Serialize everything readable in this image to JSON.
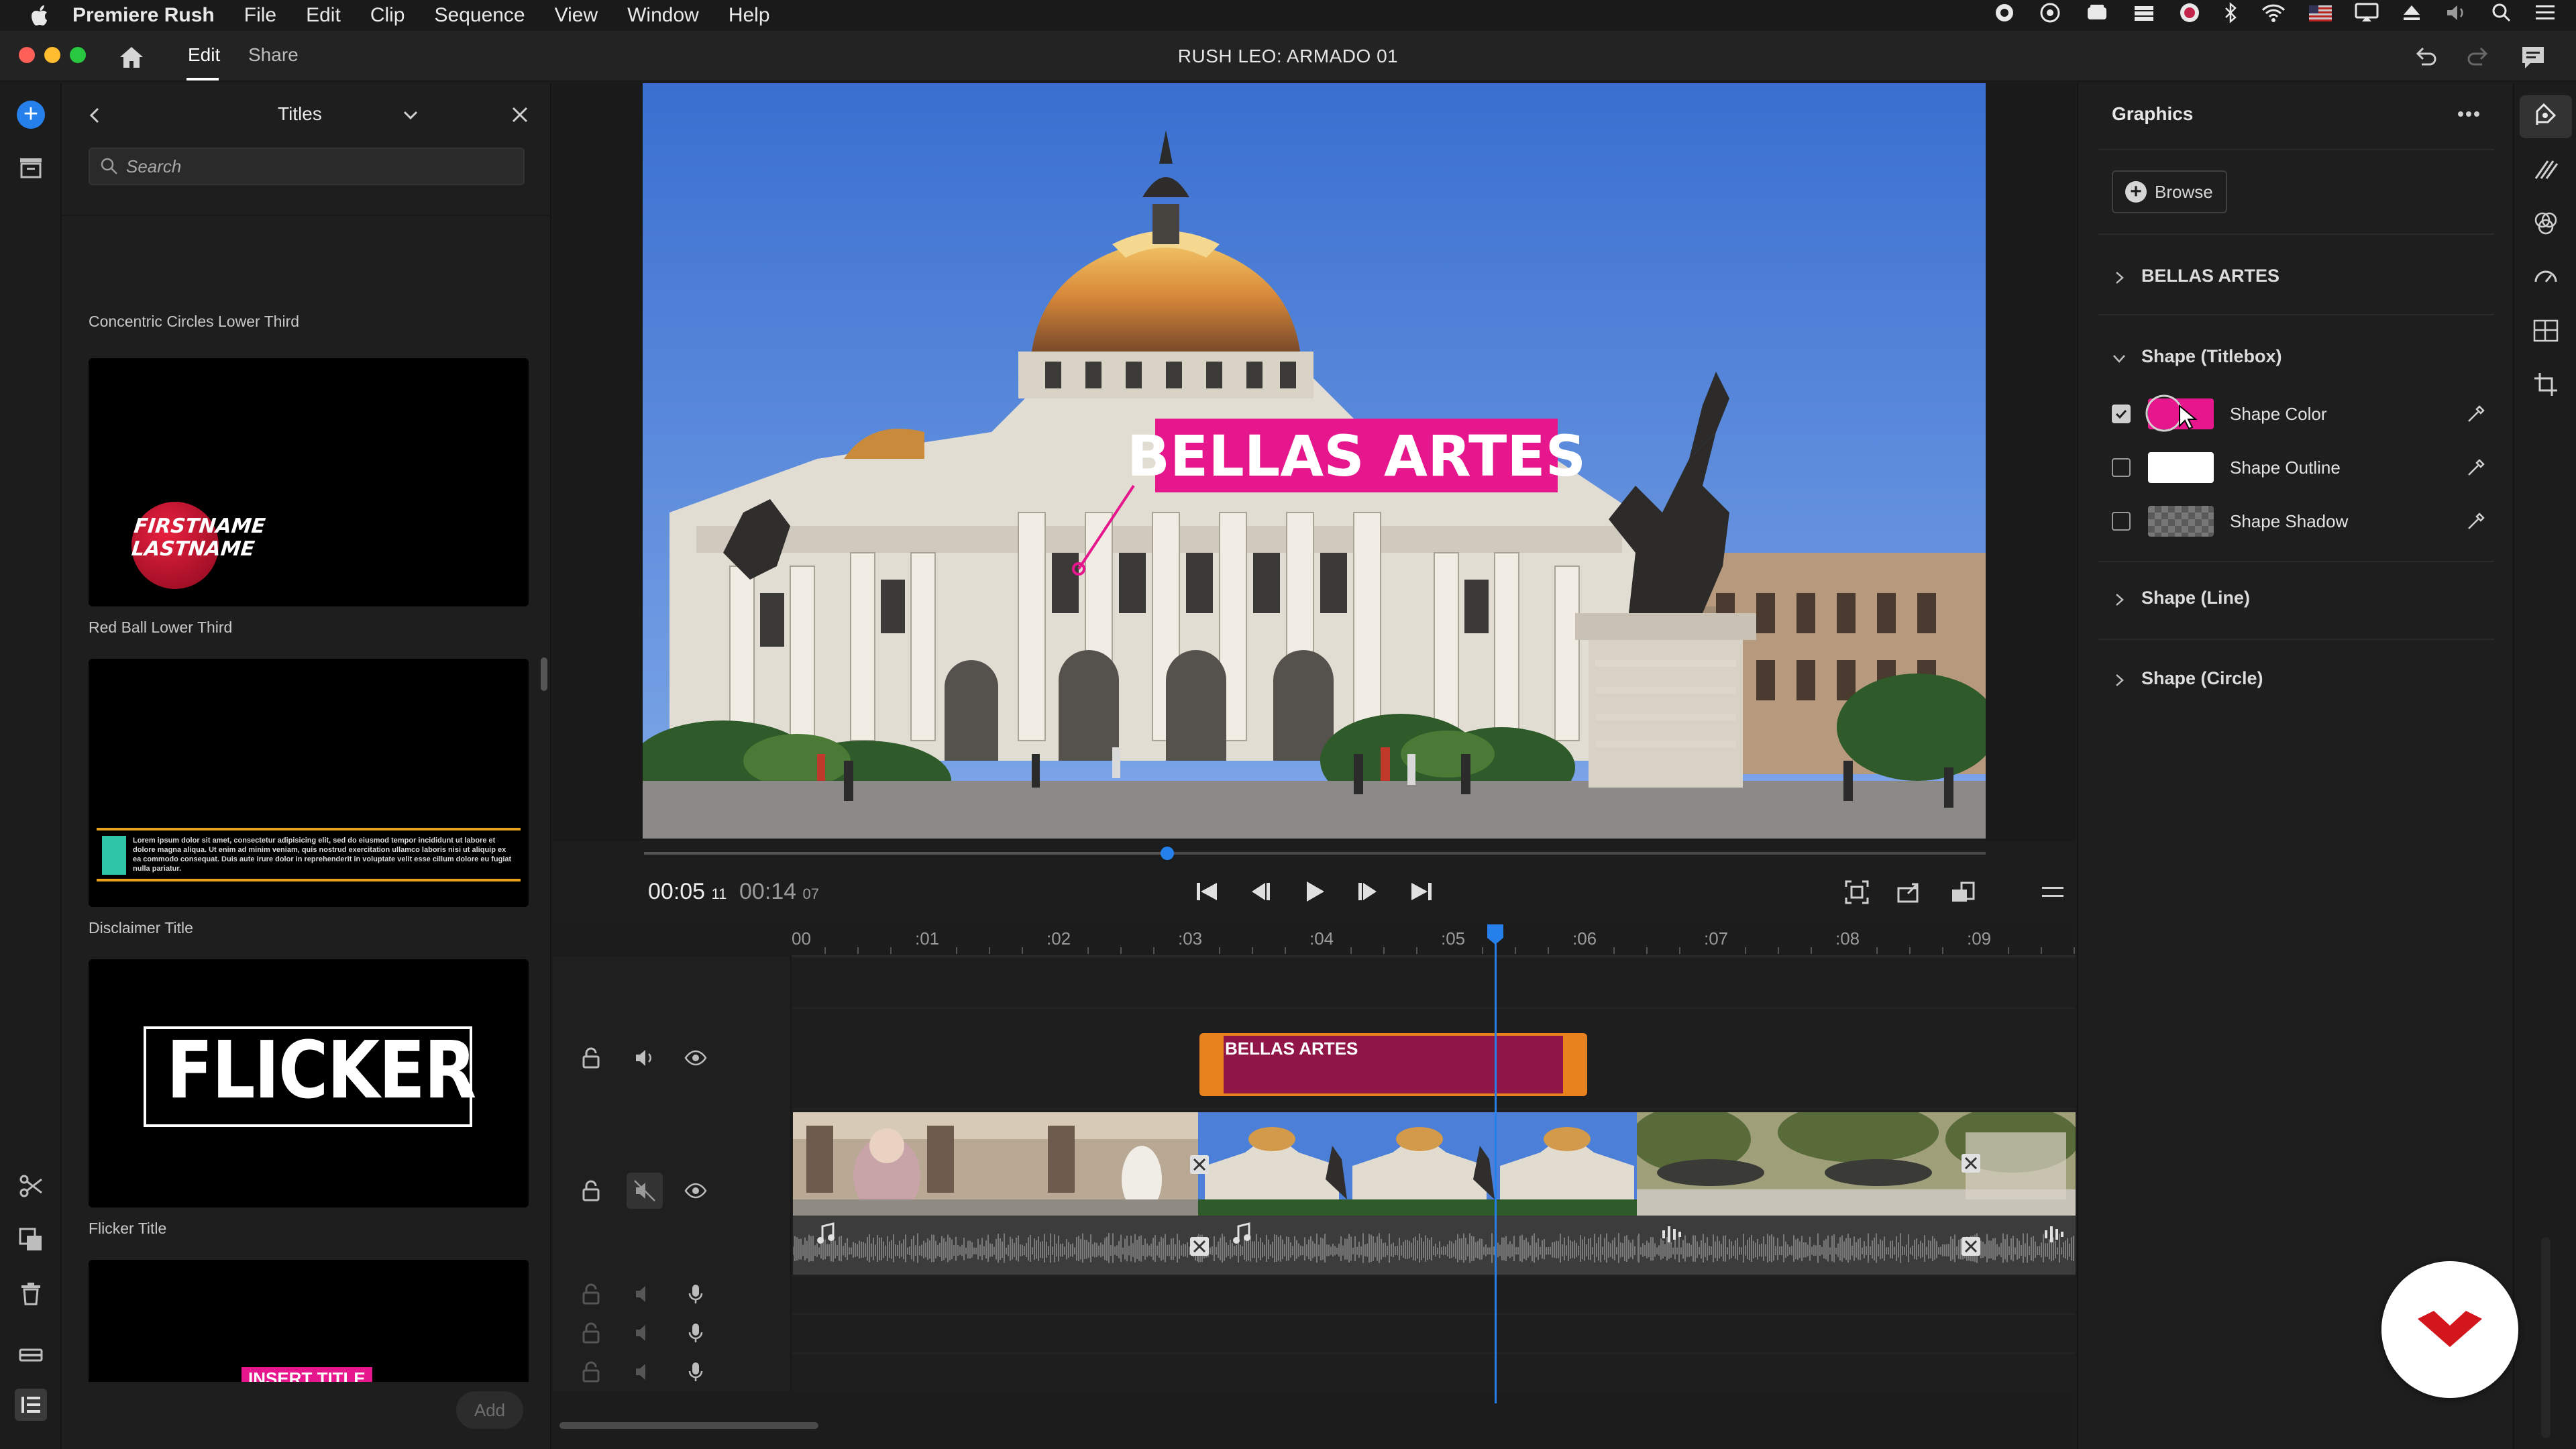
{
  "menubar": {
    "app_name": "Premiere Rush",
    "menus": [
      "File",
      "Edit",
      "Clip",
      "Sequence",
      "View",
      "Window",
      "Help"
    ]
  },
  "window": {
    "tabs": {
      "edit": "Edit",
      "share": "Share"
    },
    "project_title": "RUSH LEO: ARMADO 01"
  },
  "titles_panel": {
    "heading": "Titles",
    "search_placeholder": "Search",
    "first_label": "Concentric Circles Lower Third",
    "items": [
      {
        "label": "Red Ball Lower Third",
        "preview_text": "FIRSTNAME LASTNAME"
      },
      {
        "label": "Disclaimer Title",
        "preview_text": "Lorem ipsum dolor sit amet, consectetur adipisicing elit, sed do eiusmod tempor incididunt ut labore et dolore magna aliqua. Ut enim ad minim veniam, quis nostrud exercitation ullamco laboris nisi ut aliquip ex ea commodo consequat. Duis aute irure dolor in reprehenderit in voluptate velit esse cillum dolore eu fugiat nulla pariatur."
      },
      {
        "label": "Flicker Title",
        "preview_text": "FLICKER"
      },
      {
        "label": "",
        "preview_text": "INSERT TITLE"
      }
    ],
    "add_label": "Add"
  },
  "monitor": {
    "overlay_title": "BELLAS ARTES",
    "timecode_current": "00:05",
    "timecode_current_frames": "11",
    "timecode_total": "00:14",
    "timecode_total_frames": "07",
    "scrub_position_fraction": 0.39
  },
  "timeline": {
    "ruler_labels": [
      "00",
      ":01",
      ":02",
      ":03",
      ":04",
      ":05",
      ":06",
      ":07",
      ":08",
      ":09",
      ":"
    ],
    "playhead_seconds": 5.35,
    "title_clip_label": "BELLAS ARTES"
  },
  "graphics_panel": {
    "title": "Graphics",
    "browse_label": "Browse",
    "sections": {
      "text": "BELLAS ARTES",
      "titlebox": "Shape (Titlebox)",
      "line": "Shape (Line)",
      "circle": "Shape (Circle)"
    },
    "properties": [
      {
        "label": "Shape Color",
        "checked": true,
        "color": "#e6168c"
      },
      {
        "label": "Shape Outline",
        "checked": false,
        "color": "#ffffff"
      },
      {
        "label": "Shape Shadow",
        "checked": false,
        "color": "transparent"
      }
    ]
  },
  "colors": {
    "accent_blue": "#2680eb",
    "title_magenta": "#e6168c",
    "title_clip_orange": "#e8821e",
    "title_clip_fill": "#8f1646"
  }
}
